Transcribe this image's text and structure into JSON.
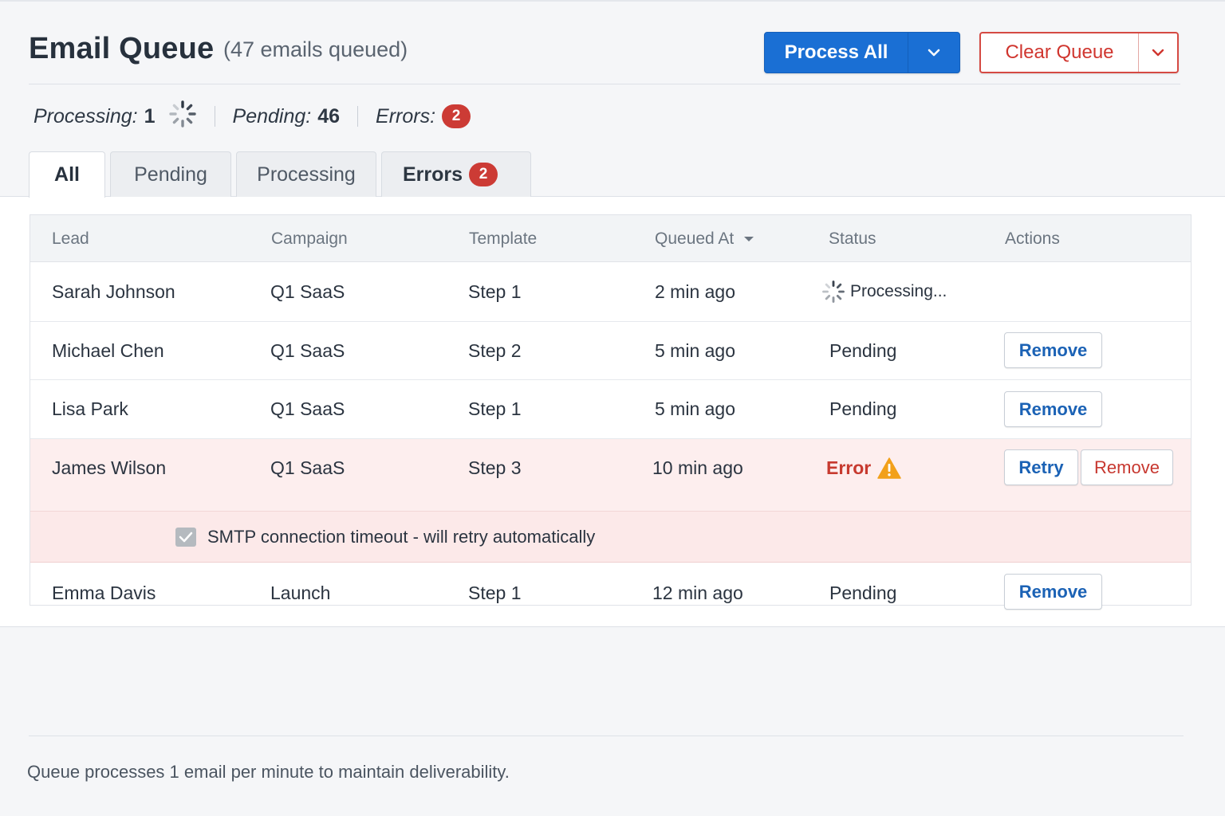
{
  "header": {
    "title": "Email Queue",
    "subtitle": "(47 emails queued)",
    "process_all_label": "Process All",
    "clear_queue_label": "Clear Queue"
  },
  "stats": {
    "processing_label": "Processing:",
    "processing_value": "1",
    "pending_label": "Pending:",
    "pending_value": "46",
    "errors_label": "Errors:",
    "errors_value": "2"
  },
  "tabs": [
    {
      "label": "All",
      "active": true
    },
    {
      "label": "Pending"
    },
    {
      "label": "Processing"
    },
    {
      "label": "Errors",
      "badge": "2"
    }
  ],
  "table": {
    "columns": [
      "Lead",
      "Campaign",
      "Template",
      "Queued At",
      "Status",
      "Actions"
    ],
    "rows": [
      {
        "lead": "Sarah Johnson",
        "campaign": "Q1 SaaS",
        "template": "Step 1",
        "queued_at": "2 min ago",
        "status": "Processing..."
      },
      {
        "lead": "Michael Chen",
        "campaign": "Q1 SaaS",
        "template": "Step 2",
        "queued_at": "5 min ago",
        "status": "Pending",
        "action_remove": "Remove"
      },
      {
        "lead": "Lisa Park",
        "campaign": "Q1 SaaS",
        "template": "Step 1",
        "queued_at": "5 min ago",
        "status": "Pending",
        "action_remove": "Remove"
      },
      {
        "lead": "James Wilson",
        "campaign": "Q1 SaaS",
        "template": "Step 3",
        "queued_at": "10 min ago",
        "status": "Error",
        "action_retry": "Retry",
        "action_remove": "Remove",
        "error_detail": "SMTP connection timeout - will retry automatically"
      },
      {
        "lead": "Emma Davis",
        "campaign": "Launch",
        "template": "Step 1",
        "queued_at": "12 min ago",
        "status": "Pending",
        "action_remove": "Remove"
      }
    ]
  },
  "footer": {
    "note": "Queue processes 1 email per minute to maintain deliverability."
  },
  "colors": {
    "primary": "#1a6fd4",
    "danger": "#d0362f",
    "error_row": "#fdeeee",
    "warning": "#f2a01a"
  },
  "icons": {
    "spinner": "spinner-icon",
    "caret": "chevron-down-icon",
    "sort": "sort-desc-icon",
    "warning": "warning-icon",
    "check": "checkbox-checked-icon"
  }
}
